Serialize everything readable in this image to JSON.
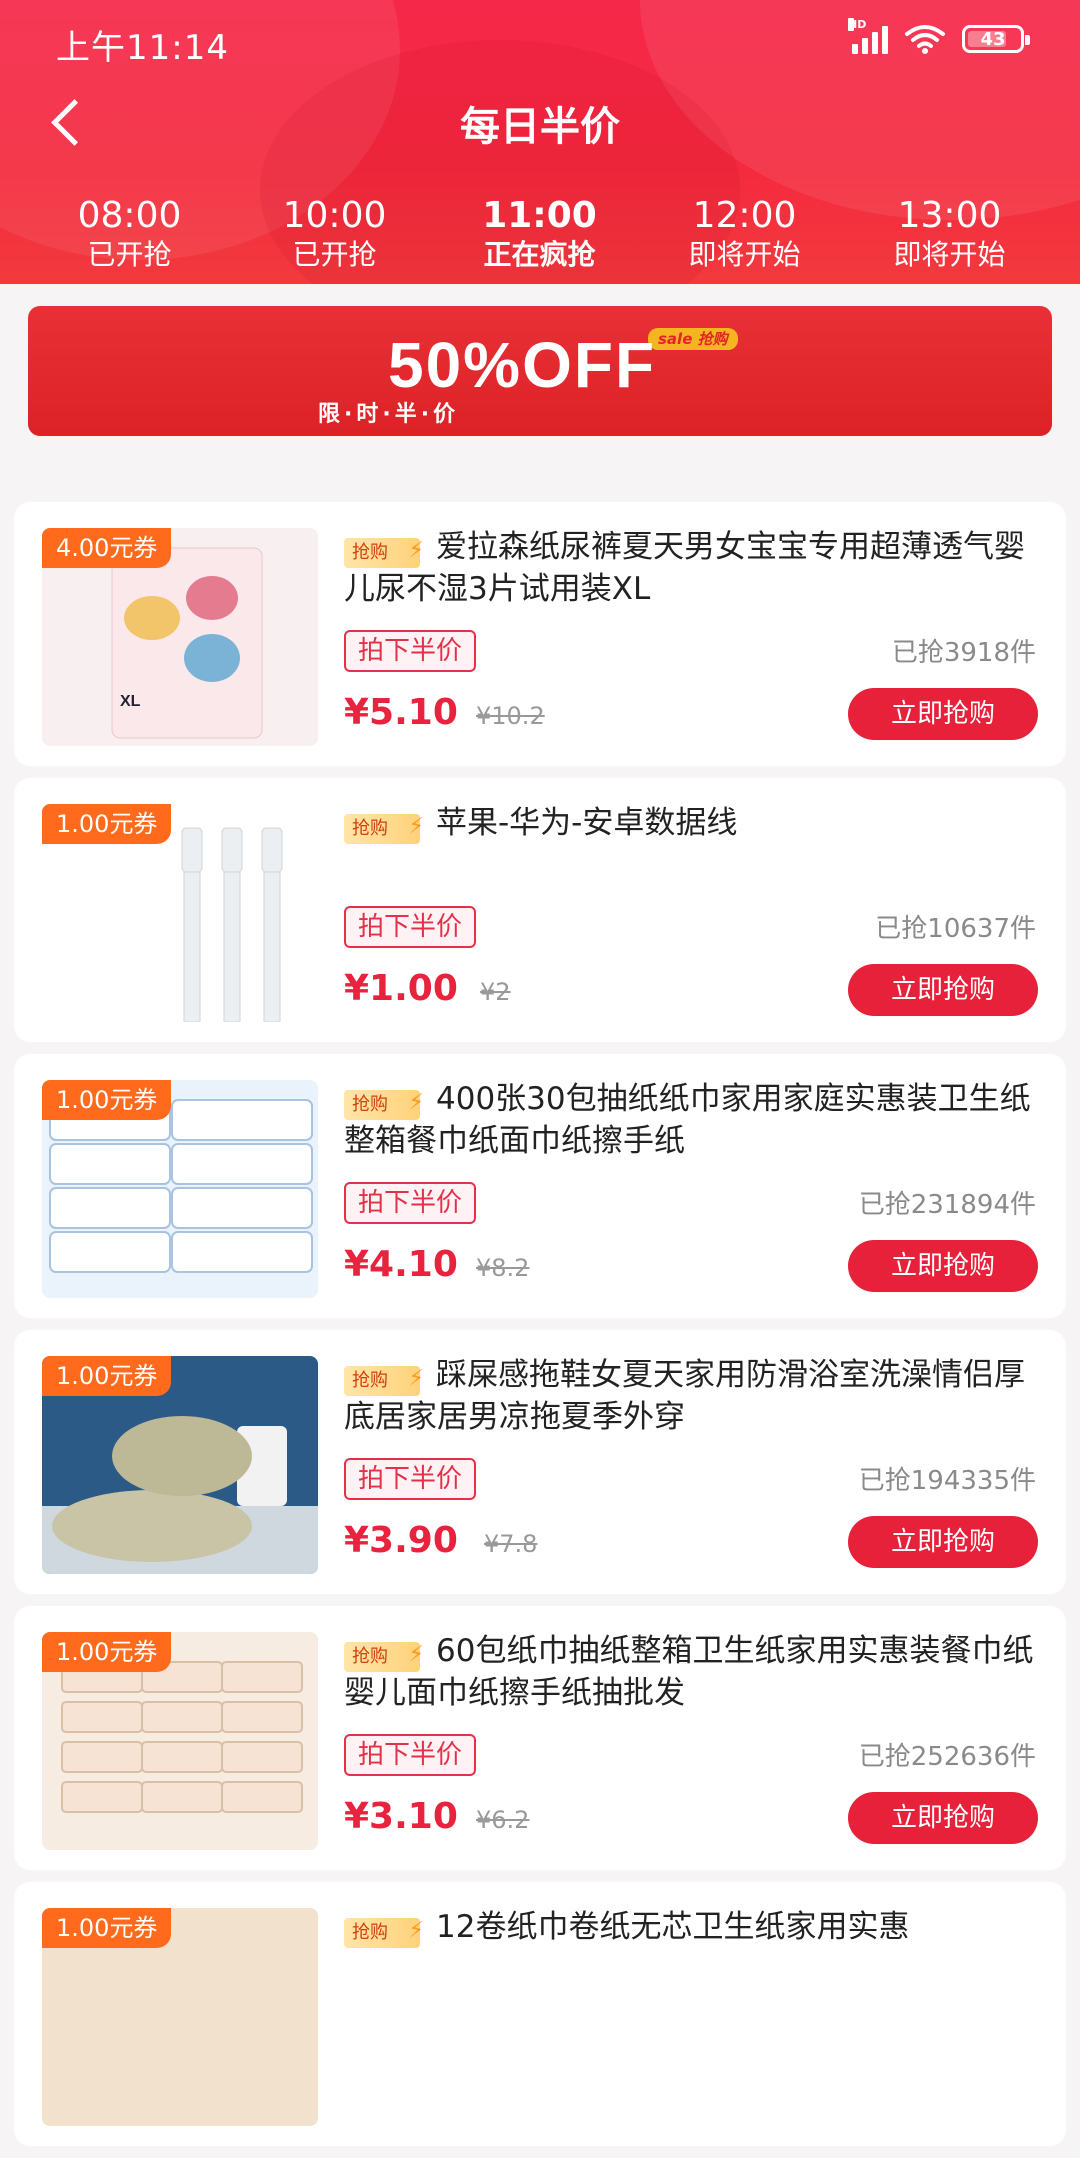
{
  "status_bar": {
    "time": "上午11:14",
    "network": "HD",
    "battery": "43"
  },
  "nav": {
    "title": "每日半价"
  },
  "time_slots": [
    {
      "time": "08:00",
      "status": "已开抢"
    },
    {
      "time": "10:00",
      "status": "已开抢"
    },
    {
      "time": "11:00",
      "status": "正在疯抢"
    },
    {
      "time": "12:00",
      "status": "即将开始"
    },
    {
      "time": "13:00",
      "status": "即将开始"
    }
  ],
  "banner": {
    "headline": "50%OFF",
    "subline": "限·时·半·价",
    "tag": "sale 抢购"
  },
  "products": [
    {
      "coupon": "4.00元券",
      "badge": "抢购",
      "title": "爱拉森纸尿裤夏天男女宝宝专用超薄透气婴儿尿不湿3片试用装XL",
      "half_tag": "拍下半价",
      "sold": "已抢3918件",
      "price": "¥5.10",
      "orig_price": "¥10.2",
      "buy_label": "立即抢购"
    },
    {
      "coupon": "1.00元券",
      "badge": "抢购",
      "title": "苹果-华为-安卓数据线",
      "half_tag": "拍下半价",
      "sold": "已抢10637件",
      "price": "¥1.00",
      "orig_price": "¥2",
      "buy_label": "立即抢购"
    },
    {
      "coupon": "1.00元券",
      "badge": "抢购",
      "title": "400张30包抽纸纸巾家用家庭实惠装卫生纸整箱餐巾纸面巾纸擦手纸",
      "half_tag": "拍下半价",
      "sold": "已抢231894件",
      "price": "¥4.10",
      "orig_price": "¥8.2",
      "buy_label": "立即抢购"
    },
    {
      "coupon": "1.00元券",
      "badge": "抢购",
      "title": "踩屎感拖鞋女夏天家用防滑浴室洗澡情侣厚底居家居男凉拖夏季外穿",
      "half_tag": "拍下半价",
      "sold": "已抢194335件",
      "price": "¥3.90",
      "orig_price": "¥7.8",
      "buy_label": "立即抢购"
    },
    {
      "coupon": "1.00元券",
      "badge": "抢购",
      "title": "60包纸巾抽纸整箱卫生纸家用实惠装餐巾纸婴儿面巾纸擦手纸抽批发",
      "half_tag": "拍下半价",
      "sold": "已抢252636件",
      "price": "¥3.10",
      "orig_price": "¥6.2",
      "buy_label": "立即抢购"
    },
    {
      "coupon": "1.00元券",
      "badge": "抢购",
      "title": "12卷纸巾卷纸无芯卫生纸家用实惠",
      "half_tag": "",
      "sold": "",
      "price": "",
      "orig_price": "",
      "buy_label": ""
    }
  ]
}
